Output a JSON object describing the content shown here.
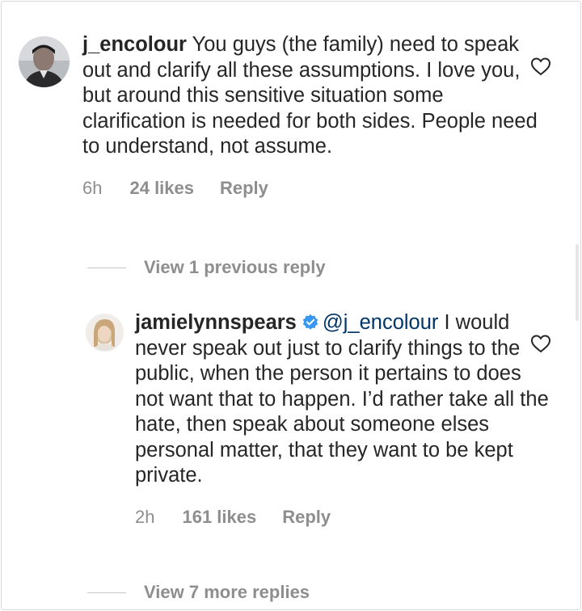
{
  "comments": [
    {
      "username": "j_encolour",
      "text": "You guys (the family) need to speak out and clarify all these assumptions. I love you, but around this sensitive situation some clarification is needed for both sides. People need to understand, not assume.",
      "time": "6h",
      "likes": "24 likes",
      "reply": "Reply",
      "view_replies": "View 1 previous reply"
    },
    {
      "username": "jamielynnspears",
      "verified": true,
      "mention": "@j_encolour",
      "text": "I would never speak out just to clarify things to the public, when the person it pertains to does not want that to happen. I’d rather take all the hate, then speak about someone elses personal matter, that they want to be kept private.",
      "time": "2h",
      "likes": "161 likes",
      "reply": "Reply",
      "view_replies": "View 7 more replies"
    }
  ],
  "colors": {
    "text": "#262626",
    "secondary": "#8e8e8e",
    "mention": "#003569",
    "verified": "#3897f0"
  },
  "icons": {
    "like": "heart-outline-icon",
    "verified": "verified-badge-icon"
  }
}
